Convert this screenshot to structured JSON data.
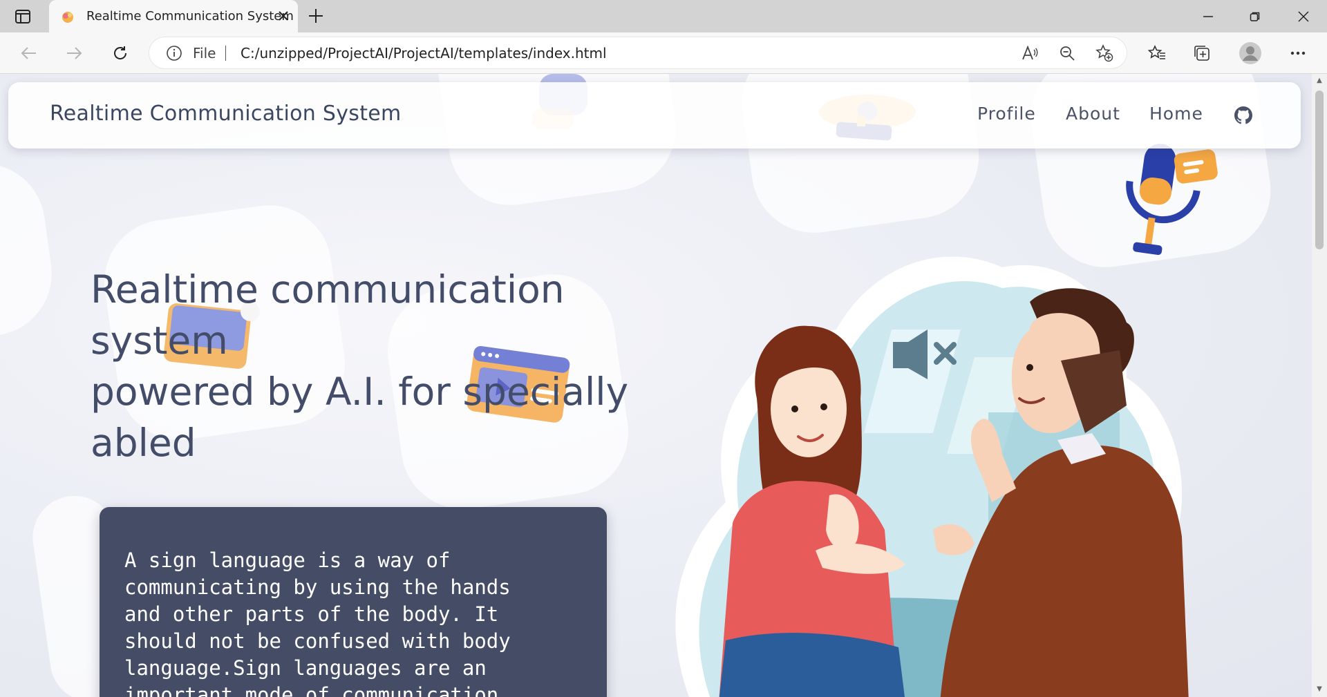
{
  "browser": {
    "tab_title": "Realtime Communication System",
    "address": {
      "scheme_label": "File",
      "url": "C:/unzipped/ProjectAI/ProjectAI/templates/index.html"
    },
    "icons": [
      "sidebar-icon",
      "close-icon",
      "new-tab-icon",
      "minimize-icon",
      "restore-icon",
      "window-close-icon",
      "back-icon",
      "forward-icon",
      "refresh-icon",
      "info-icon",
      "read-aloud-icon",
      "zoom-out-icon",
      "add-favorite-icon",
      "favorites-icon",
      "collections-icon",
      "profile-icon",
      "more-icon"
    ]
  },
  "navbar": {
    "brand": "Realtime Communication System",
    "links": [
      "Profile",
      "About",
      "Home"
    ],
    "github_icon": "github-icon"
  },
  "hero": {
    "headline_lines": [
      "Realtime communication",
      "system",
      "powered by A.I. for specially",
      "abled"
    ],
    "description": "A sign language is a way of\ncommunicating by using the hands\nand other parts of the body. It\nshould not be confused with body\nlanguage.Sign languages are an\nimportant mode of communication"
  },
  "colors": {
    "heading": "#434c68",
    "desc_box": "#454c65",
    "accent_orange": "#f5a742",
    "accent_blue": "#2a3fa8"
  }
}
